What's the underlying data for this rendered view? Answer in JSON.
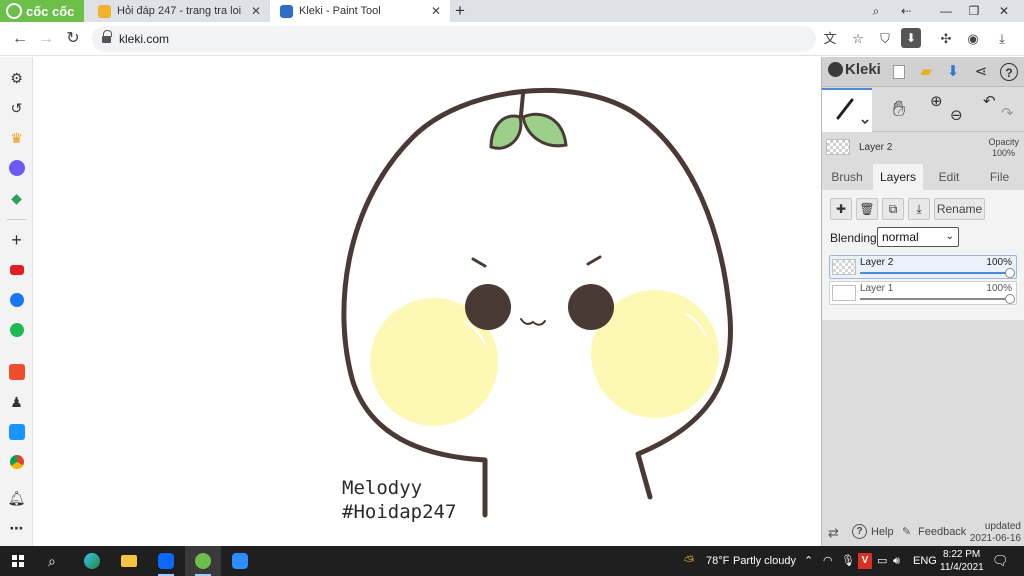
{
  "browser": {
    "brand": "cốc cốc",
    "tabs": [
      {
        "title": "Hỏi đáp 247 - trang tra loi",
        "active": false
      },
      {
        "title": "Kleki - Paint Tool",
        "active": true
      }
    ],
    "url": "kleki.com",
    "colors": {
      "brand": "#6cc04a",
      "tabstrip": "#dee1e6"
    }
  },
  "sidebar": {
    "icons": [
      "settings-icon",
      "history-icon",
      "crown-icon",
      "messenger-icon",
      "game-icon",
      "add-icon",
      "youtube-icon",
      "facebook-icon",
      "spotify-icon",
      "shopee-icon",
      "game-character-icon",
      "tiki-icon",
      "chrome-extension-icon",
      "bell-icon",
      "more-icon"
    ]
  },
  "canvas": {
    "drawing": "cute bun character with sprout",
    "caption_line1": "Melodyy",
    "caption_line2": "#Hoidap247",
    "colors": {
      "outline": "#4a3a36",
      "eyes": "#4a3a36",
      "cheeks": "#fdf9b4",
      "leaves": "#9ccf8a"
    }
  },
  "kleki": {
    "logo": "Kleki",
    "current_layer": "Layer 2",
    "opacity_label": "Opacity",
    "opacity_value": "100%",
    "tabs": [
      "Brush",
      "Layers",
      "Edit",
      "File"
    ],
    "active_tab": "Layers",
    "rename_label": "Rename",
    "blending_label": "Blending",
    "blending_value": "normal",
    "layers": [
      {
        "name": "Layer 2",
        "opacity": "100%",
        "opacity_fraction": 1.0,
        "selected": true
      },
      {
        "name": "Layer 1",
        "opacity": "100%",
        "opacity_fraction": 1.0,
        "selected": false
      }
    ],
    "footer": {
      "help": "Help",
      "feedback": "Feedback",
      "updated_label": "updated",
      "updated_date": "2021-06-16"
    },
    "colors": {
      "accent": "#4a8ad6",
      "panel": "#dcdcdc"
    }
  },
  "taskbar": {
    "weather_temp": "78°F",
    "weather_text": "Partly cloudy",
    "language": "ENG",
    "time": "8:22 PM",
    "date": "11/4/2021"
  }
}
